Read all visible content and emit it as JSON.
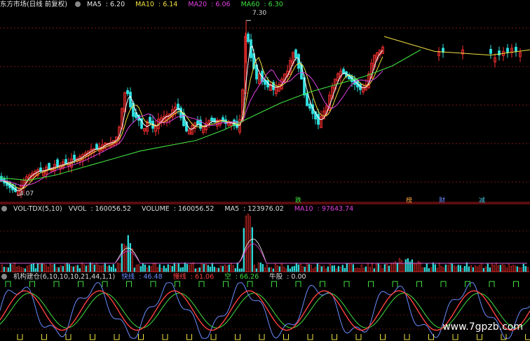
{
  "chart_data": [
    {
      "type": "candlestick",
      "title": "东方市场(日线 前复权)",
      "indicators": [
        {
          "label": "MA5",
          "value": "6.20",
          "color": "#ffffff"
        },
        {
          "label": "MA10",
          "value": "6.14",
          "color": "#f0e040"
        },
        {
          "label": "MA20",
          "value": "6.06",
          "color": "#e040e0"
        },
        {
          "label": "MA60",
          "value": "6.30",
          "color": "#40e040"
        }
      ],
      "annotations": {
        "high": "7.30",
        "low": "4.07"
      },
      "ylim": [
        3.9,
        7.5
      ],
      "price_path": [
        [
          0,
          4.3
        ],
        [
          6,
          4.25
        ],
        [
          12,
          4.18
        ],
        [
          18,
          4.12
        ],
        [
          24,
          4.07
        ],
        [
          30,
          4.2
        ],
        [
          36,
          4.35
        ],
        [
          42,
          4.4
        ],
        [
          48,
          4.45
        ],
        [
          54,
          4.5
        ],
        [
          60,
          4.45
        ],
        [
          66,
          4.55
        ],
        [
          72,
          4.5
        ],
        [
          78,
          4.6
        ],
        [
          84,
          4.55
        ],
        [
          90,
          4.65
        ],
        [
          96,
          4.6
        ],
        [
          102,
          4.7
        ],
        [
          108,
          4.68
        ],
        [
          114,
          4.75
        ],
        [
          120,
          4.8
        ],
        [
          126,
          4.85
        ],
        [
          132,
          4.9
        ],
        [
          138,
          4.88
        ],
        [
          144,
          4.95
        ],
        [
          150,
          5.0
        ],
        [
          156,
          5.0
        ],
        [
          162,
          5.05
        ],
        [
          168,
          5.15
        ],
        [
          172,
          5.45
        ],
        [
          176,
          5.85
        ],
        [
          180,
          6.05
        ],
        [
          184,
          5.8
        ],
        [
          188,
          5.55
        ],
        [
          192,
          5.45
        ],
        [
          196,
          5.5
        ],
        [
          200,
          5.35
        ],
        [
          204,
          5.2
        ],
        [
          208,
          5.35
        ],
        [
          212,
          5.45
        ],
        [
          216,
          5.3
        ],
        [
          220,
          5.25
        ],
        [
          224,
          5.4
        ],
        [
          228,
          5.5
        ],
        [
          232,
          5.45
        ],
        [
          236,
          5.55
        ],
        [
          240,
          5.5
        ],
        [
          244,
          5.6
        ],
        [
          248,
          5.65
        ],
        [
          252,
          5.7
        ],
        [
          256,
          5.55
        ],
        [
          260,
          5.4
        ],
        [
          264,
          5.25
        ],
        [
          268,
          5.2
        ],
        [
          272,
          5.3
        ],
        [
          276,
          5.35
        ],
        [
          280,
          5.4
        ],
        [
          284,
          5.3
        ],
        [
          288,
          5.25
        ],
        [
          292,
          5.35
        ],
        [
          296,
          5.4
        ],
        [
          300,
          5.45
        ],
        [
          304,
          5.38
        ],
        [
          308,
          5.4
        ],
        [
          312,
          5.45
        ],
        [
          316,
          5.42
        ],
        [
          320,
          5.38
        ],
        [
          324,
          5.35
        ],
        [
          328,
          5.4
        ],
        [
          332,
          5.35
        ],
        [
          336,
          5.3
        ],
        [
          340,
          5.28
        ],
        [
          344,
          5.6
        ],
        [
          348,
          6.4
        ],
        [
          351,
          7.3
        ],
        [
          354,
          6.9
        ],
        [
          358,
          6.6
        ],
        [
          362,
          6.4
        ],
        [
          366,
          6.2
        ],
        [
          370,
          6.3
        ],
        [
          374,
          6.15
        ],
        [
          378,
          6.1
        ],
        [
          382,
          6.05
        ],
        [
          386,
          6.1
        ],
        [
          390,
          6.0
        ],
        [
          394,
          6.05
        ],
        [
          398,
          6.1
        ],
        [
          402,
          6.2
        ],
        [
          406,
          6.3
        ],
        [
          410,
          6.35
        ],
        [
          414,
          6.55
        ],
        [
          418,
          6.7
        ],
        [
          422,
          6.6
        ],
        [
          426,
          6.4
        ],
        [
          430,
          6.2
        ],
        [
          434,
          5.9
        ],
        [
          438,
          5.7
        ],
        [
          442,
          5.65
        ],
        [
          446,
          5.55
        ],
        [
          450,
          5.45
        ],
        [
          454,
          5.35
        ],
        [
          458,
          5.5
        ],
        [
          462,
          5.6
        ],
        [
          466,
          5.7
        ],
        [
          470,
          5.9
        ],
        [
          474,
          6.05
        ],
        [
          478,
          6.2
        ],
        [
          482,
          6.3
        ],
        [
          486,
          6.35
        ],
        [
          490,
          6.3
        ],
        [
          494,
          6.25
        ],
        [
          498,
          6.2
        ],
        [
          502,
          6.15
        ],
        [
          506,
          6.1
        ],
        [
          510,
          6.05
        ],
        [
          514,
          6.0
        ],
        [
          518,
          6.05
        ],
        [
          522,
          6.1
        ],
        [
          526,
          6.3
        ],
        [
          530,
          6.5
        ],
        [
          534,
          6.65
        ],
        [
          538,
          6.7
        ],
        [
          542,
          6.75
        ],
        [
          546,
          6.8
        ]
      ],
      "ma60_path": [
        [
          0,
          4.35
        ],
        [
          40,
          4.3
        ],
        [
          80,
          4.4
        ],
        [
          120,
          4.55
        ],
        [
          160,
          4.7
        ],
        [
          200,
          4.85
        ],
        [
          240,
          4.95
        ],
        [
          280,
          5.05
        ],
        [
          320,
          5.25
        ],
        [
          360,
          5.5
        ],
        [
          400,
          5.75
        ],
        [
          440,
          5.95
        ],
        [
          480,
          6.1
        ],
        [
          520,
          6.25
        ],
        [
          560,
          6.45
        ],
        [
          600,
          6.75
        ]
      ],
      "bands": [
        [
          548,
          7.0
        ],
        [
          620,
          6.72
        ],
        [
          700,
          6.65
        ],
        [
          756,
          6.75
        ]
      ]
    },
    {
      "type": "bar",
      "title": "VOL-TDX(5,10)",
      "indicators": [
        {
          "label": "VVOL",
          "value": "160056.52",
          "color": "#dddddd"
        },
        {
          "label": "VOLUME",
          "value": "160056.52",
          "color": "#dddddd"
        },
        {
          "label": "MA5",
          "value": "123976.02",
          "color": "#dddddd"
        },
        {
          "label": "MA10",
          "value": "97643.74",
          "color": "#e040e0"
        }
      ]
    },
    {
      "type": "line",
      "title": "机构建仓(6,10,10,10,21,44,1,1)",
      "indicators": [
        {
          "label": "快线",
          "value": "46.48",
          "color": "#6a8cff"
        },
        {
          "label": "慢线",
          "value": "61.06",
          "color": "#ff4040"
        },
        {
          "label": "空",
          "value": "66.26",
          "color": "#40e040"
        },
        {
          "label": "牛股",
          "value": "0.00",
          "color": "#dddddd"
        }
      ]
    }
  ],
  "markers": [
    {
      "text": "跌",
      "color": "#40e040"
    },
    {
      "text": "榜",
      "color": "#f0a040"
    },
    {
      "text": "财",
      "color": "#6a8cff"
    },
    {
      "text": "减",
      "color": "#40c0e0"
    }
  ],
  "watermark": "www.7gpzb.com"
}
